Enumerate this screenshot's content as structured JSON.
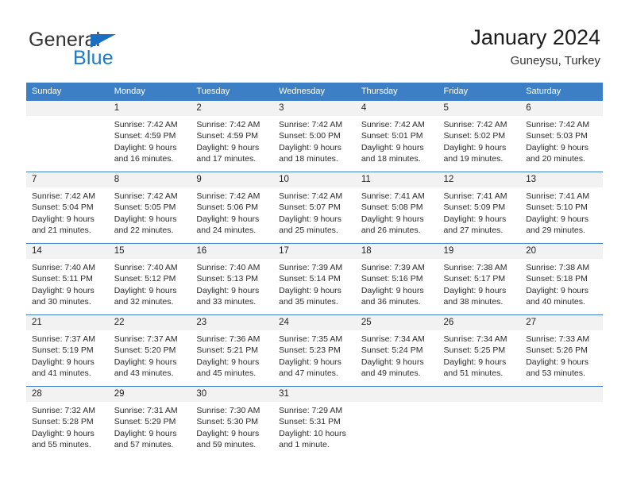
{
  "branding": {
    "logo_primary": "General",
    "logo_secondary": "Blue"
  },
  "header": {
    "title": "January 2024",
    "subtitle": "Guneysu, Turkey"
  },
  "colors": {
    "header_blue": "#3c7fc4",
    "logo_blue": "#1f7ac4",
    "daynum_band": "#f2f2f2"
  },
  "weekday_headers": [
    "Sunday",
    "Monday",
    "Tuesday",
    "Wednesday",
    "Thursday",
    "Friday",
    "Saturday"
  ],
  "labels": {
    "sunrise": "Sunrise:",
    "sunset": "Sunset:",
    "daylight": "Daylight:"
  },
  "weeks": [
    [
      {
        "day": "",
        "lines": []
      },
      {
        "day": "1",
        "lines": [
          "Sunrise: 7:42 AM",
          "Sunset: 4:59 PM",
          "Daylight: 9 hours",
          "and 16 minutes."
        ]
      },
      {
        "day": "2",
        "lines": [
          "Sunrise: 7:42 AM",
          "Sunset: 4:59 PM",
          "Daylight: 9 hours",
          "and 17 minutes."
        ]
      },
      {
        "day": "3",
        "lines": [
          "Sunrise: 7:42 AM",
          "Sunset: 5:00 PM",
          "Daylight: 9 hours",
          "and 18 minutes."
        ]
      },
      {
        "day": "4",
        "lines": [
          "Sunrise: 7:42 AM",
          "Sunset: 5:01 PM",
          "Daylight: 9 hours",
          "and 18 minutes."
        ]
      },
      {
        "day": "5",
        "lines": [
          "Sunrise: 7:42 AM",
          "Sunset: 5:02 PM",
          "Daylight: 9 hours",
          "and 19 minutes."
        ]
      },
      {
        "day": "6",
        "lines": [
          "Sunrise: 7:42 AM",
          "Sunset: 5:03 PM",
          "Daylight: 9 hours",
          "and 20 minutes."
        ]
      }
    ],
    [
      {
        "day": "7",
        "lines": [
          "Sunrise: 7:42 AM",
          "Sunset: 5:04 PM",
          "Daylight: 9 hours",
          "and 21 minutes."
        ]
      },
      {
        "day": "8",
        "lines": [
          "Sunrise: 7:42 AM",
          "Sunset: 5:05 PM",
          "Daylight: 9 hours",
          "and 22 minutes."
        ]
      },
      {
        "day": "9",
        "lines": [
          "Sunrise: 7:42 AM",
          "Sunset: 5:06 PM",
          "Daylight: 9 hours",
          "and 24 minutes."
        ]
      },
      {
        "day": "10",
        "lines": [
          "Sunrise: 7:42 AM",
          "Sunset: 5:07 PM",
          "Daylight: 9 hours",
          "and 25 minutes."
        ]
      },
      {
        "day": "11",
        "lines": [
          "Sunrise: 7:41 AM",
          "Sunset: 5:08 PM",
          "Daylight: 9 hours",
          "and 26 minutes."
        ]
      },
      {
        "day": "12",
        "lines": [
          "Sunrise: 7:41 AM",
          "Sunset: 5:09 PM",
          "Daylight: 9 hours",
          "and 27 minutes."
        ]
      },
      {
        "day": "13",
        "lines": [
          "Sunrise: 7:41 AM",
          "Sunset: 5:10 PM",
          "Daylight: 9 hours",
          "and 29 minutes."
        ]
      }
    ],
    [
      {
        "day": "14",
        "lines": [
          "Sunrise: 7:40 AM",
          "Sunset: 5:11 PM",
          "Daylight: 9 hours",
          "and 30 minutes."
        ]
      },
      {
        "day": "15",
        "lines": [
          "Sunrise: 7:40 AM",
          "Sunset: 5:12 PM",
          "Daylight: 9 hours",
          "and 32 minutes."
        ]
      },
      {
        "day": "16",
        "lines": [
          "Sunrise: 7:40 AM",
          "Sunset: 5:13 PM",
          "Daylight: 9 hours",
          "and 33 minutes."
        ]
      },
      {
        "day": "17",
        "lines": [
          "Sunrise: 7:39 AM",
          "Sunset: 5:14 PM",
          "Daylight: 9 hours",
          "and 35 minutes."
        ]
      },
      {
        "day": "18",
        "lines": [
          "Sunrise: 7:39 AM",
          "Sunset: 5:16 PM",
          "Daylight: 9 hours",
          "and 36 minutes."
        ]
      },
      {
        "day": "19",
        "lines": [
          "Sunrise: 7:38 AM",
          "Sunset: 5:17 PM",
          "Daylight: 9 hours",
          "and 38 minutes."
        ]
      },
      {
        "day": "20",
        "lines": [
          "Sunrise: 7:38 AM",
          "Sunset: 5:18 PM",
          "Daylight: 9 hours",
          "and 40 minutes."
        ]
      }
    ],
    [
      {
        "day": "21",
        "lines": [
          "Sunrise: 7:37 AM",
          "Sunset: 5:19 PM",
          "Daylight: 9 hours",
          "and 41 minutes."
        ]
      },
      {
        "day": "22",
        "lines": [
          "Sunrise: 7:37 AM",
          "Sunset: 5:20 PM",
          "Daylight: 9 hours",
          "and 43 minutes."
        ]
      },
      {
        "day": "23",
        "lines": [
          "Sunrise: 7:36 AM",
          "Sunset: 5:21 PM",
          "Daylight: 9 hours",
          "and 45 minutes."
        ]
      },
      {
        "day": "24",
        "lines": [
          "Sunrise: 7:35 AM",
          "Sunset: 5:23 PM",
          "Daylight: 9 hours",
          "and 47 minutes."
        ]
      },
      {
        "day": "25",
        "lines": [
          "Sunrise: 7:34 AM",
          "Sunset: 5:24 PM",
          "Daylight: 9 hours",
          "and 49 minutes."
        ]
      },
      {
        "day": "26",
        "lines": [
          "Sunrise: 7:34 AM",
          "Sunset: 5:25 PM",
          "Daylight: 9 hours",
          "and 51 minutes."
        ]
      },
      {
        "day": "27",
        "lines": [
          "Sunrise: 7:33 AM",
          "Sunset: 5:26 PM",
          "Daylight: 9 hours",
          "and 53 minutes."
        ]
      }
    ],
    [
      {
        "day": "28",
        "lines": [
          "Sunrise: 7:32 AM",
          "Sunset: 5:28 PM",
          "Daylight: 9 hours",
          "and 55 minutes."
        ]
      },
      {
        "day": "29",
        "lines": [
          "Sunrise: 7:31 AM",
          "Sunset: 5:29 PM",
          "Daylight: 9 hours",
          "and 57 minutes."
        ]
      },
      {
        "day": "30",
        "lines": [
          "Sunrise: 7:30 AM",
          "Sunset: 5:30 PM",
          "Daylight: 9 hours",
          "and 59 minutes."
        ]
      },
      {
        "day": "31",
        "lines": [
          "Sunrise: 7:29 AM",
          "Sunset: 5:31 PM",
          "Daylight: 10 hours",
          "and 1 minute."
        ]
      },
      {
        "day": "",
        "lines": []
      },
      {
        "day": "",
        "lines": []
      },
      {
        "day": "",
        "lines": []
      }
    ]
  ]
}
